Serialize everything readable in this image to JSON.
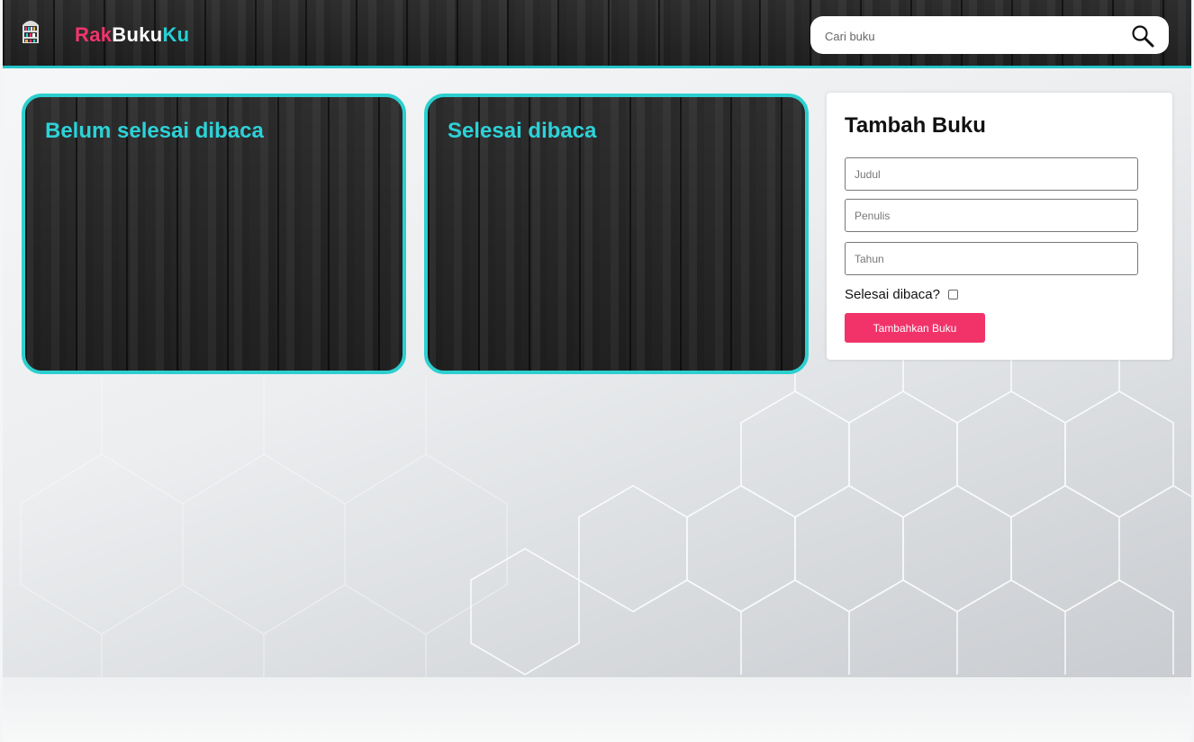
{
  "header": {
    "brand": {
      "part1": "Rak",
      "part2": "Buku",
      "part3": "Ku"
    },
    "search": {
      "placeholder": "Cari buku",
      "value": ""
    }
  },
  "shelves": [
    {
      "title": "Belum selesai dibaca"
    },
    {
      "title": "Selesai dibaca"
    }
  ],
  "form": {
    "title": "Tambah Buku",
    "fields": {
      "judul": {
        "placeholder": "Judul",
        "value": ""
      },
      "penulis": {
        "placeholder": "Penulis",
        "value": ""
      },
      "tahun": {
        "placeholder": "Tahun",
        "value": ""
      }
    },
    "checkbox_label": "Selesai dibaca?",
    "checkbox_checked": false,
    "submit_label": "Tambahkan Buku"
  },
  "icons": {
    "logo": "bookshelf-icon",
    "search": "search-icon"
  },
  "colors": {
    "accent_teal": "#22c4c8",
    "brand_pink": "#f0356d",
    "button_pink": "#f1336a"
  }
}
